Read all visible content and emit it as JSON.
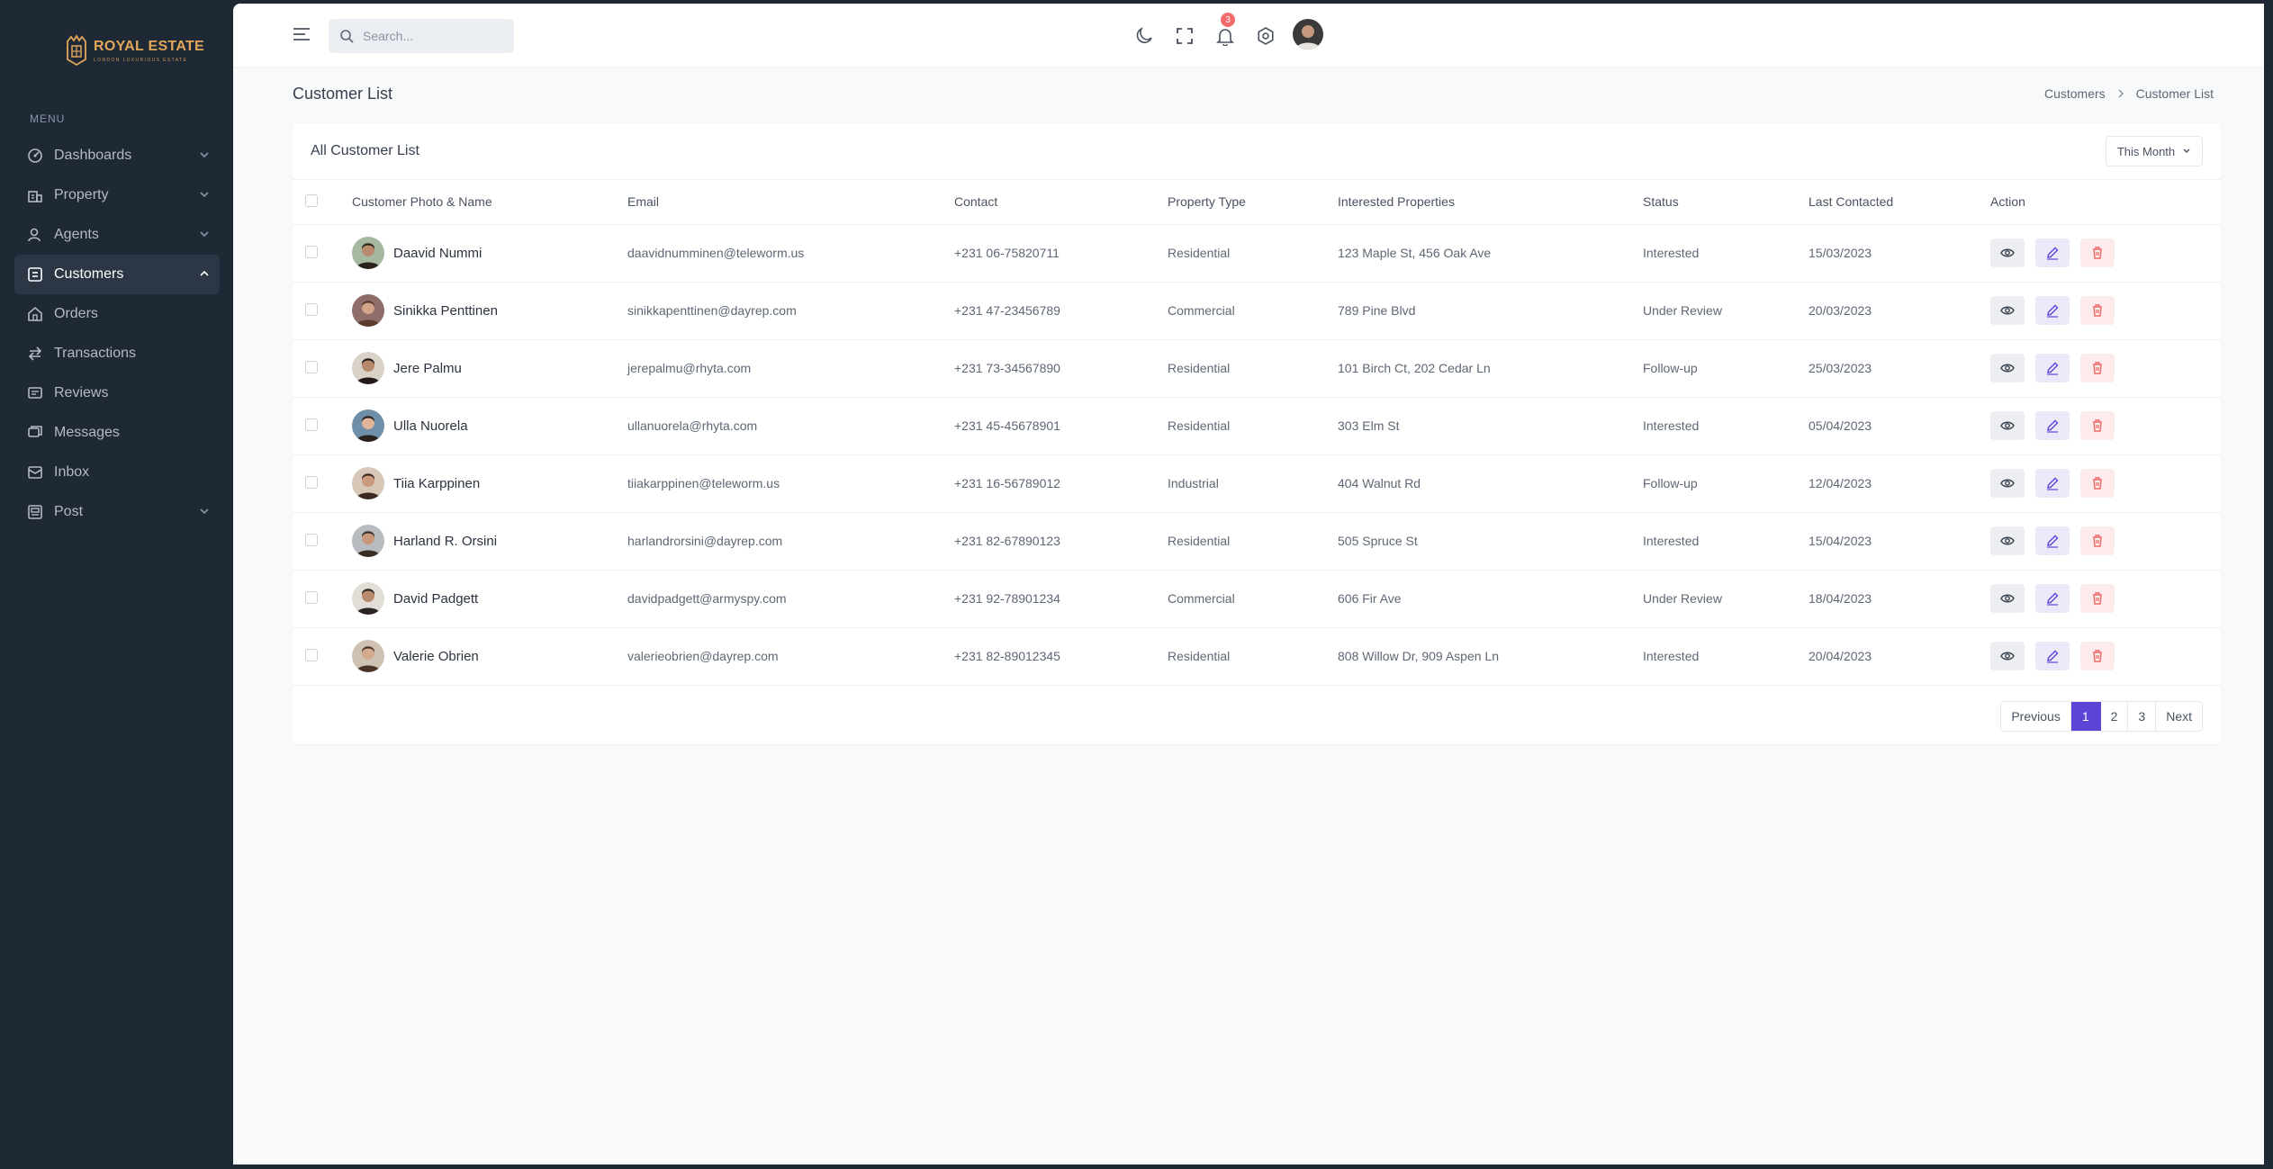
{
  "brand": {
    "name": "ROYAL ESTATE",
    "tagline": "LONDON LUXURIOUS ESTATE"
  },
  "colors": {
    "sidebar_bg": "#1f2936",
    "accent": "#5b44d6",
    "brand_gold": "#e2a65a",
    "badge": "#f36b6b"
  },
  "sidebar": {
    "menu_label": "MENU",
    "items": [
      {
        "label": "Dashboards",
        "icon": "dashboard-icon",
        "expandable": true
      },
      {
        "label": "Property",
        "icon": "property-icon",
        "expandable": true
      },
      {
        "label": "Agents",
        "icon": "agents-icon",
        "expandable": true
      },
      {
        "label": "Customers",
        "icon": "customers-icon",
        "expandable": true,
        "active": true
      },
      {
        "label": "Orders",
        "icon": "orders-icon"
      },
      {
        "label": "Transactions",
        "icon": "transactions-icon"
      },
      {
        "label": "Reviews",
        "icon": "reviews-icon"
      },
      {
        "label": "Messages",
        "icon": "messages-icon"
      },
      {
        "label": "Inbox",
        "icon": "inbox-icon"
      },
      {
        "label": "Post",
        "icon": "post-icon",
        "expandable": true
      }
    ]
  },
  "topbar": {
    "search_placeholder": "Search...",
    "notification_count": "3"
  },
  "page": {
    "title": "Customer List",
    "breadcrumb": [
      "Customers",
      "Customer List"
    ]
  },
  "card": {
    "title": "All Customer List",
    "filter_label": "This Month",
    "columns": [
      "Customer Photo & Name",
      "Email",
      "Contact",
      "Property Type",
      "Interested Properties",
      "Status",
      "Last Contacted",
      "Action"
    ],
    "rows": [
      {
        "name": "Daavid Nummi",
        "email": "daavidnumminen@teleworm.us",
        "contact": "+231 06-75820711",
        "type": "Residential",
        "properties": "123 Maple St, 456 Oak Ave",
        "status": "Interested",
        "date": "15/03/2023"
      },
      {
        "name": "Sinikka Penttinen",
        "email": "sinikkapenttinen@dayrep.com",
        "contact": "+231 47-23456789",
        "type": "Commercial",
        "properties": "789 Pine Blvd",
        "status": "Under Review",
        "date": "20/03/2023"
      },
      {
        "name": "Jere Palmu",
        "email": "jerepalmu@rhyta.com",
        "contact": "+231 73-34567890",
        "type": "Residential",
        "properties": "101 Birch Ct, 202 Cedar Ln",
        "status": "Follow-up",
        "date": "25/03/2023"
      },
      {
        "name": "Ulla Nuorela",
        "email": "ullanuorela@rhyta.com",
        "contact": "+231 45-45678901",
        "type": "Residential",
        "properties": "303 Elm St",
        "status": "Interested",
        "date": "05/04/2023"
      },
      {
        "name": "Tiia Karppinen",
        "email": "tiiakarppinen@teleworm.us",
        "contact": "+231 16-56789012",
        "type": "Industrial",
        "properties": "404 Walnut Rd",
        "status": "Follow-up",
        "date": "12/04/2023"
      },
      {
        "name": "Harland R. Orsini",
        "email": "harlandrorsini@dayrep.com",
        "contact": "+231 82-67890123",
        "type": "Residential",
        "properties": "505 Spruce St",
        "status": "Interested",
        "date": "15/04/2023"
      },
      {
        "name": "David Padgett",
        "email": "davidpadgett@armyspy.com",
        "contact": "+231 92-78901234",
        "type": "Commercial",
        "properties": "606 Fir Ave",
        "status": "Under Review",
        "date": "18/04/2023"
      },
      {
        "name": "Valerie Obrien",
        "email": "valerieobrien@dayrep.com",
        "contact": "+231 82-89012345",
        "type": "Residential",
        "properties": "808 Willow Dr, 909 Aspen Ln",
        "status": "Interested",
        "date": "20/04/2023"
      }
    ]
  },
  "pagination": {
    "previous": "Previous",
    "pages": [
      "1",
      "2",
      "3"
    ],
    "current": "1",
    "next": "Next"
  }
}
